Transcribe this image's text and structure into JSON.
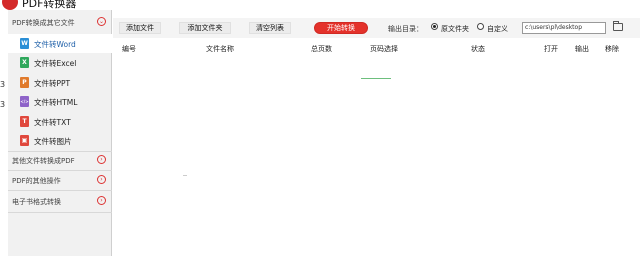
{
  "app": {
    "title": "PDF转换器"
  },
  "left_edge": [
    "3",
    "3"
  ],
  "sidebar": {
    "section1": {
      "label": "PDF转换成其它文件"
    },
    "items": [
      {
        "label": "文件转Word",
        "icon": "word-icon",
        "color": "#2b8fd6",
        "letter": "W",
        "selected": true
      },
      {
        "label": "文件转Excel",
        "icon": "excel-icon",
        "color": "#2fa85c",
        "letter": "X",
        "selected": false
      },
      {
        "label": "文件转PPT",
        "icon": "ppt-icon",
        "color": "#e07a2c",
        "letter": "P",
        "selected": false
      },
      {
        "label": "文件转HTML",
        "icon": "html-icon",
        "color": "#8e63c8",
        "letter": "</>",
        "selected": false
      },
      {
        "label": "文件转TXT",
        "icon": "txt-icon",
        "color": "#e0483d",
        "letter": "T",
        "selected": false
      },
      {
        "label": "文件转图片",
        "icon": "image-icon",
        "color": "#e0483d",
        "letter": "图",
        "selected": false
      }
    ],
    "section2": {
      "label": "其他文件转换成PDF"
    },
    "section3": {
      "label": "PDF的其他操作"
    },
    "section4": {
      "label": "电子书格式转换"
    }
  },
  "toolbar": {
    "add_file": "添加文件",
    "add_folder": "添加文件夹",
    "clear_list": "清空列表",
    "start": "开始转换",
    "output_label": "输出目录：",
    "radio_original": "原文件夹",
    "radio_custom": "自定义",
    "path_value": "c:\\users\\pl\\desktop"
  },
  "table": {
    "columns": [
      "编号",
      "文件名称",
      "总页数",
      "页码选择",
      "状态",
      "打开",
      "输出",
      "移除"
    ]
  },
  "colors": {
    "accent": "#e4322b",
    "selected_text": "#1e5fa8"
  }
}
